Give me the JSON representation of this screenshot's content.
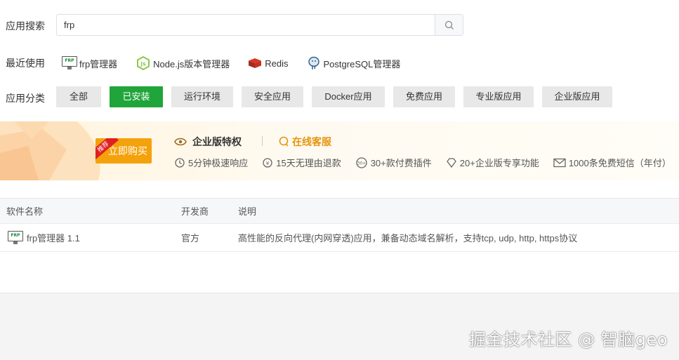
{
  "search": {
    "label": "应用搜索",
    "value": "frp",
    "icon": "search-icon"
  },
  "recent": {
    "label": "最近使用",
    "items": [
      {
        "label": "frp管理器",
        "icon": "frp-icon"
      },
      {
        "label": "Node.js版本管理器",
        "icon": "nodejs-icon"
      },
      {
        "label": "Redis",
        "icon": "redis-icon"
      },
      {
        "label": "PostgreSQL管理器",
        "icon": "postgresql-icon"
      }
    ]
  },
  "categories": {
    "label": "应用分类",
    "items": [
      "全部",
      "已安装",
      "运行环境",
      "安全应用",
      "Docker应用",
      "免费应用",
      "专业版应用",
      "企业版应用"
    ],
    "active": "已安装"
  },
  "banner": {
    "buy_label": "立即购买",
    "ribbon": "推荐",
    "enterprise_title": "企业版特权",
    "service_label": "在线客服",
    "features": [
      "5分钟极速响应",
      "15天无理由退款",
      "30+款付费插件",
      "20+企业版专享功能",
      "1000条免费短信（年付）"
    ],
    "accent_color": "#f4a20c"
  },
  "table": {
    "headers": [
      "软件名称",
      "开发商",
      "说明"
    ],
    "rows": [
      {
        "name": "frp管理器 1.1",
        "vendor": "官方",
        "description": "高性能的反向代理(内网穿透)应用，兼备动态域名解析，支持tcp, udp, http, https协议"
      }
    ]
  },
  "watermark": "掘金技术社区 @ 智脑geo",
  "colors": {
    "primary": "#20a53a",
    "warning": "#f4a20c",
    "service": "#e6940e"
  }
}
